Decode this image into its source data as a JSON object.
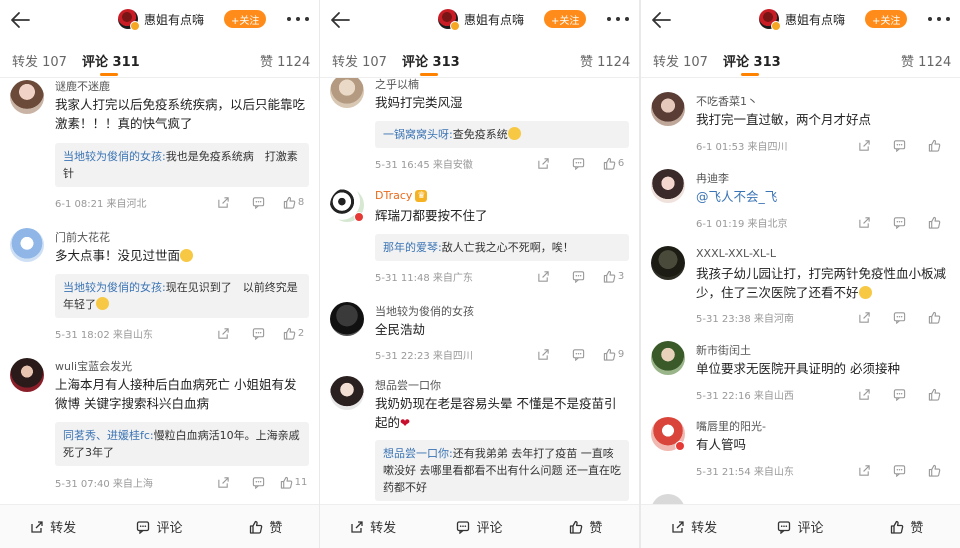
{
  "author": {
    "name": "惠姐有点嗨",
    "follow_label": "+关注"
  },
  "bottom": {
    "repost": "转发",
    "comment": "评论",
    "like": "赞"
  },
  "panels": [
    {
      "tabs": {
        "repost": "转发 107",
        "comment": "评论 311",
        "like": "赞 1124"
      },
      "comments": [
        {
          "user": "谜鹿不迷鹿",
          "text": "我家人打完以后免疫系统疾病，以后只能靠吃激素！！！真的快气疯了",
          "reply_user": "当地较为俊俏的女孩:",
          "reply_text": "我也是免疫系统病　打激素针",
          "meta": "6-1 08:21  来自河北",
          "likes": "8"
        },
        {
          "user": "门前大花花",
          "text": "多大点事！没见过世面",
          "reply_user": "当地较为俊俏的女孩:",
          "reply_text": "现在见识到了　以前终究是年轻了",
          "meta": "5-31 18:02  来自山东",
          "likes": "2"
        },
        {
          "user": "wuli宝蓝会发光",
          "text": "上海本月有人接种后白血病死亡 小姐姐有发微博 关键字搜索科兴白血病",
          "reply_user": "同茗秀、进媛桂fc:",
          "reply_text": "慢粒白血病活10年。上海亲戚死了3年了",
          "meta": "5-31 07:40  来自上海",
          "likes": "11"
        }
      ]
    },
    {
      "tabs": {
        "repost": "转发 107",
        "comment": "评论 313",
        "like": "赞 1124"
      },
      "comments": [
        {
          "user": "之乎以楠",
          "text": "我妈打完类风湿",
          "reply_user": "一锅窝窝头呀:",
          "reply_text": "查免疫系统",
          "meta": "5-31 16:45  来自安徽",
          "likes": "6"
        },
        {
          "user": "DTracy",
          "text": "辉瑞刀都要按不住了",
          "reply_user": "那年的爱琴:",
          "reply_text": "敌人亡我之心不死啊，唉！",
          "meta": "5-31 11:48  来自广东",
          "likes": "3"
        },
        {
          "user": "当地较为俊俏的女孩",
          "text": "全民浩劫",
          "meta": "5-31 22:23  来自四川",
          "likes": "9"
        },
        {
          "user": "想品尝一口你",
          "text": "我奶奶现在老是容易头晕 不懂是不是疫苗引起的",
          "reply_user": "想品尝一口你:",
          "reply_text": "还有我弟弟 去年打了疫苗 一直咳嗽没好 去哪里看都看不出有什么问题 还一直在吃药都不好"
        }
      ]
    },
    {
      "tabs": {
        "repost": "转发 107",
        "comment": "评论 313",
        "like": "赞 1124"
      },
      "comments": [
        {
          "user": "不吃香菜1丶",
          "text": "我打完一直过敏，两个月才好点",
          "meta": "6-1 01:53  来自四川"
        },
        {
          "user": "冉迪李",
          "text": "@飞人不会_飞",
          "meta": "6-1 01:19  来自北京"
        },
        {
          "user": "XXXL-XXL-XL-L",
          "text": "我孩子幼儿园让打，打完两针免疫性血小板减少，住了三次医院了还看不好",
          "meta": "5-31 23:38  来自河南"
        },
        {
          "user": "新市街闰土",
          "text": "单位要求无医院开具证明的 必须接种",
          "meta": "5-31 22:16  来自山西"
        },
        {
          "user": "嘴唇里的阳光-",
          "text": "有人管吗",
          "meta": "5-31 21:54  来自山东"
        }
      ]
    }
  ],
  "icons": [
    "back-arrow-icon",
    "more-icon",
    "share-icon",
    "comment-icon",
    "like-icon",
    "crown-icon",
    "emoji-icon",
    "heart-icon"
  ],
  "colors": {
    "accent": "#ff8200",
    "follow_bg": "#ff8c1a",
    "reply_name": "#3b74b5",
    "meta": "#999999"
  }
}
